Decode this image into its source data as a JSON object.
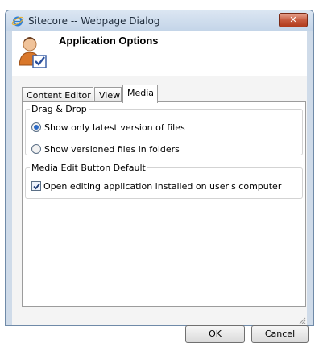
{
  "window": {
    "title": "Sitecore -- Webpage Dialog",
    "close_glyph": "✕"
  },
  "header": {
    "title": "Application Options",
    "icon": "user-check-icon"
  },
  "tabs": [
    {
      "label": "Content Editor",
      "active": false
    },
    {
      "label": "View",
      "active": false
    },
    {
      "label": "Media",
      "active": true
    }
  ],
  "groups": {
    "drag_drop": {
      "legend": "Drag & Drop",
      "options": [
        {
          "label": "Show only latest version of files",
          "checked": true
        },
        {
          "label": "Show versioned files in folders",
          "checked": false
        }
      ]
    },
    "media_edit": {
      "legend": "Media Edit Button Default",
      "option": {
        "label": "Open editing application installed on user's computer",
        "checked": true
      }
    }
  },
  "buttons": {
    "ok": "OK",
    "cancel": "Cancel"
  },
  "colors": {
    "close_button": "#c65a3e",
    "radio_selected": "#2d6bc7"
  }
}
